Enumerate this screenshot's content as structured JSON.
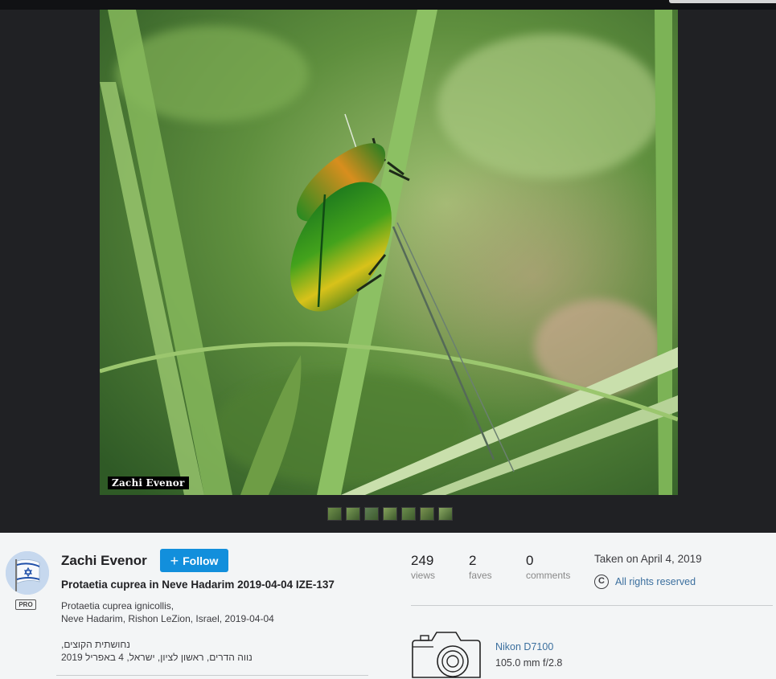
{
  "photo": {
    "watermark": "Zachi Evenor",
    "thumbnail_count": 7
  },
  "owner": {
    "name": "Zachi Evenor",
    "badge": "PRO",
    "follow_label": "Follow"
  },
  "photo_info": {
    "title": "Protaetia cuprea in Neve Hadarim 2019-04-04 IZE-137",
    "description_en_line1": "Protaetia cuprea ignicollis,",
    "description_en_line2": "Neve Hadarim, Rishon LeZion, Israel, 2019-04-04",
    "description_he_line1": "נחושתית הקוצים,",
    "description_he_line2": "נווה הדרים, ראשון לציון, ישראל, 4 באפריל 2019"
  },
  "stats": {
    "views": {
      "value": "249",
      "label": "views"
    },
    "faves": {
      "value": "2",
      "label": "faves"
    },
    "comments": {
      "value": "0",
      "label": "comments"
    }
  },
  "meta": {
    "taken": "Taken on April 4, 2019",
    "copyright_symbol": "C",
    "rights": "All rights reserved"
  },
  "camera": {
    "model": "Nikon D7100",
    "lens": "105.0 mm f/2.8"
  },
  "colors": {
    "follow_button": "#128fdc",
    "link": "#3b6f9e",
    "stage_background": "#202124"
  }
}
